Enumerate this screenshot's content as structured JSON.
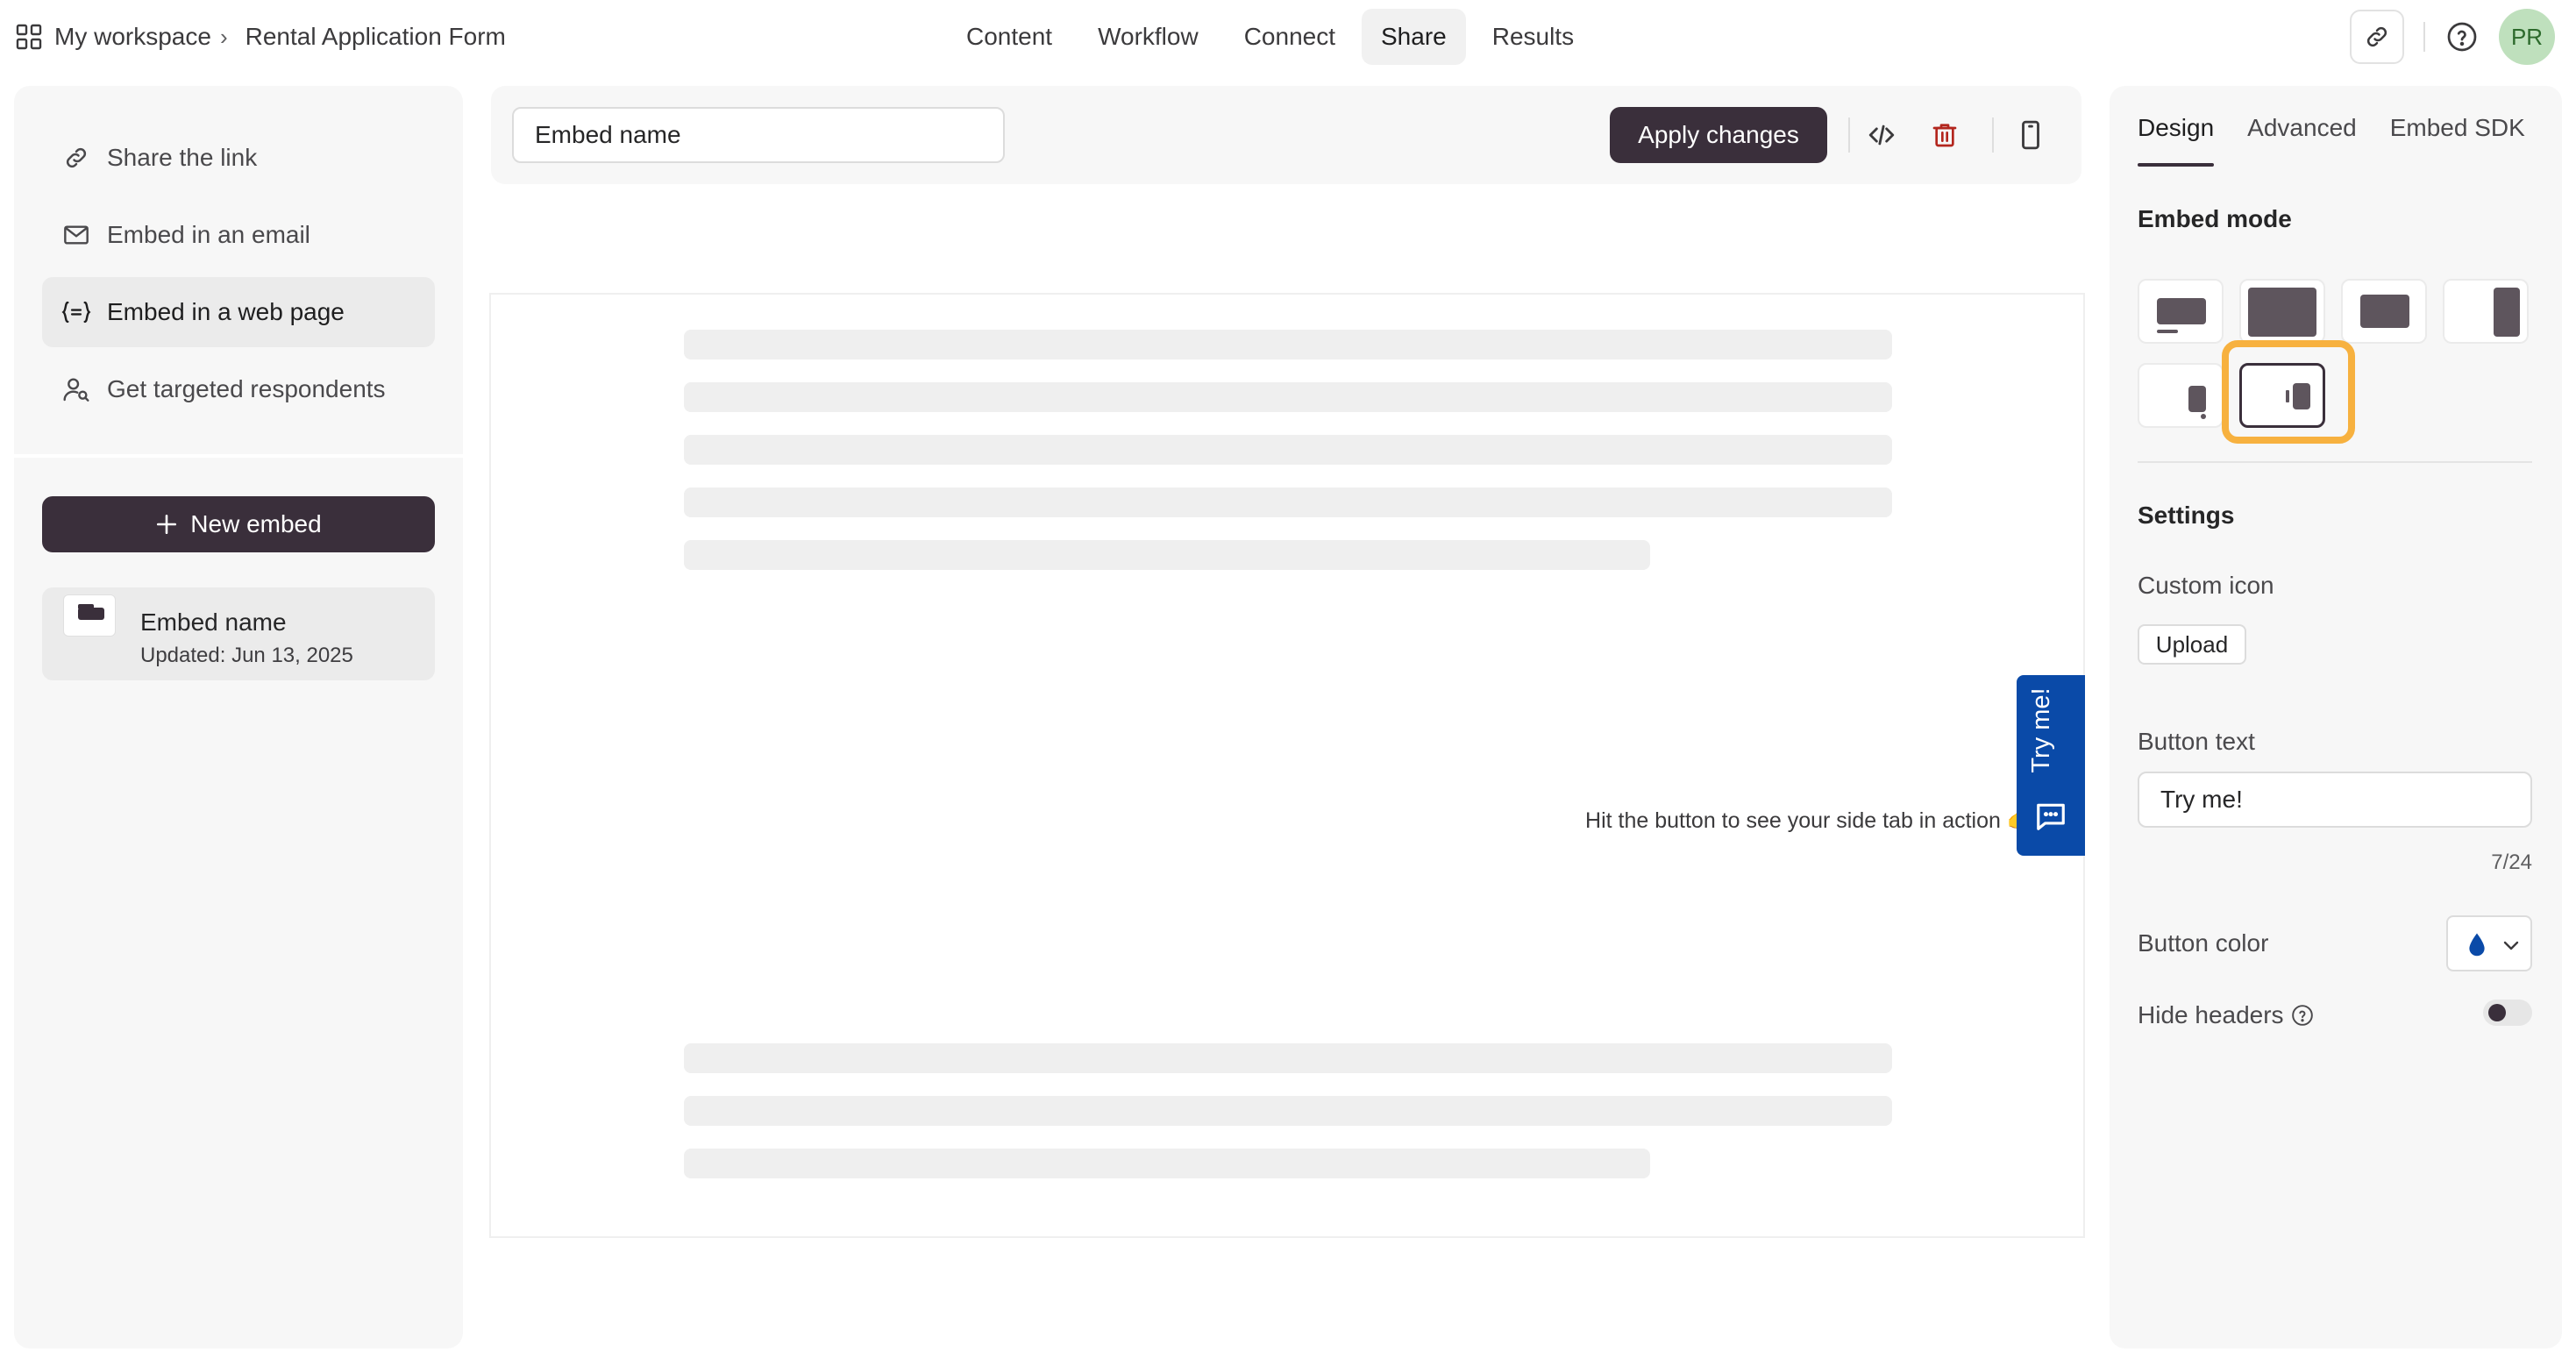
{
  "breadcrumb": {
    "workspace": "My workspace",
    "separator": "›",
    "form_name": "Rental Application Form"
  },
  "topnav": {
    "tabs": [
      {
        "label": "Content"
      },
      {
        "label": "Workflow"
      },
      {
        "label": "Connect"
      },
      {
        "label": "Share",
        "active": true
      },
      {
        "label": "Results"
      }
    ]
  },
  "user": {
    "initials": "PR"
  },
  "share_menu": {
    "items": [
      {
        "label": "Share the link",
        "icon": "link-icon"
      },
      {
        "label": "Embed in an email",
        "icon": "mail-icon"
      },
      {
        "label": "Embed in a web page",
        "icon": "embed-code-icon",
        "active": true
      },
      {
        "label": "Get targeted respondents",
        "icon": "user-search-icon"
      }
    ]
  },
  "new_embed": {
    "label": "New embed"
  },
  "embeds": [
    {
      "name": "Embed name",
      "updated": "Updated: Jun 13, 2025"
    }
  ],
  "toolbar": {
    "embed_name_value": "Embed name",
    "apply_label": "Apply changes"
  },
  "preview": {
    "message": "Hit the button to see your side tab in action 👉",
    "sidetab_label": "Try me!"
  },
  "design_panel": {
    "tabs": [
      {
        "label": "Design",
        "active": true
      },
      {
        "label": "Advanced"
      },
      {
        "label": "Embed SDK"
      }
    ],
    "embed_mode_title": "Embed mode",
    "settings_title": "Settings",
    "custom_icon_label": "Custom icon",
    "upload_label": "Upload",
    "button_text_label": "Button text",
    "button_text_value": "Try me!",
    "button_text_counter": "7/24",
    "button_color_label": "Button color",
    "button_color": "#0a4aa8",
    "hide_headers_label": "Hide headers",
    "hide_headers_on": false
  },
  "colors": {
    "accent_dark": "#3a2f3b",
    "sidetab_blue": "#0a4aa8",
    "highlight": "#f7b13f",
    "delete_red": "#b3261e"
  }
}
